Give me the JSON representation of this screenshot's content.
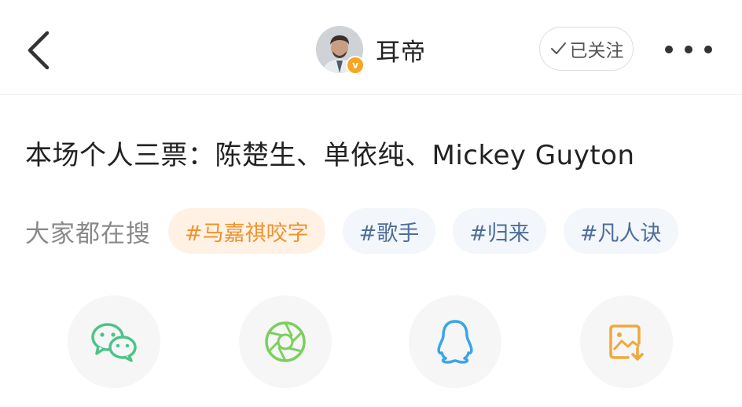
{
  "header": {
    "username": "耳帝",
    "follow_label": "已关注",
    "verified_mark": "v"
  },
  "post": {
    "text": "本场个人三票：陈楚生、单依纯、Mickey Guyton"
  },
  "search": {
    "label": "大家都在搜",
    "tags": [
      {
        "text": "#马嘉祺咬字",
        "style": "hot"
      },
      {
        "text": "#歌手",
        "style": "normal"
      },
      {
        "text": "#归来",
        "style": "normal"
      },
      {
        "text": "#凡人诀",
        "style": "normal"
      }
    ]
  },
  "share": {
    "items": [
      {
        "icon": "wechat-icon",
        "color": "#4cc38a"
      },
      {
        "icon": "moments-icon",
        "color": "#7ccf5e"
      },
      {
        "icon": "qq-icon",
        "color": "#3ba4e8"
      },
      {
        "icon": "save-image-icon",
        "color": "#f0a93a"
      }
    ]
  },
  "colors": {
    "hot_tag_bg": "#fff2e4",
    "hot_tag_text": "#f0912e",
    "normal_tag_bg": "#f3f6fa",
    "normal_tag_text": "#4c6e9a",
    "verified_badge": "#f5a623"
  }
}
